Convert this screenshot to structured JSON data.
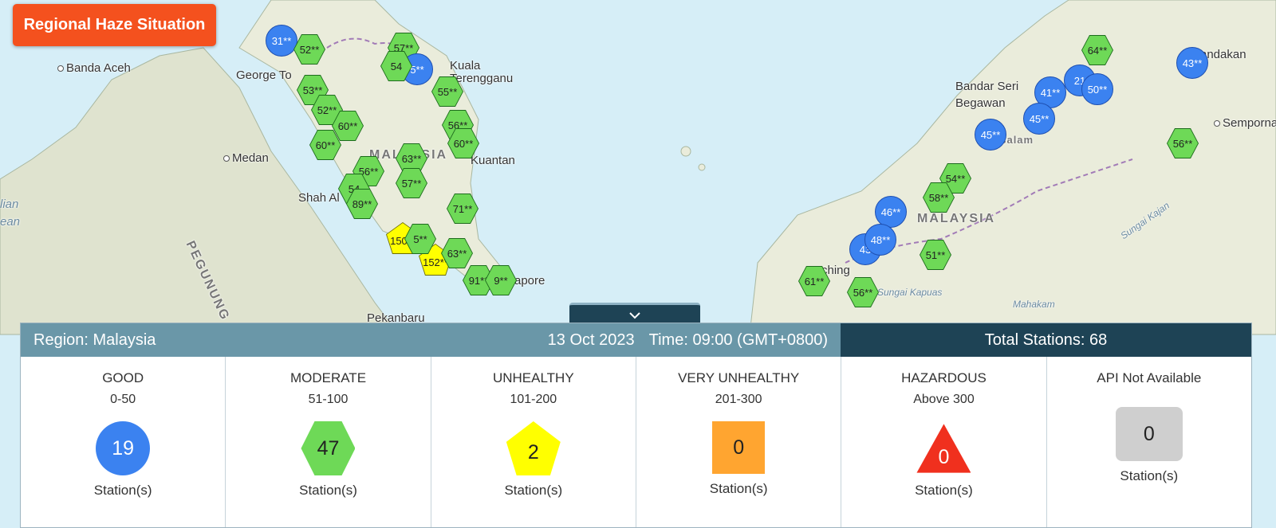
{
  "title_button": "Regional Haze Situation",
  "places": [
    "Banda Aceh",
    "George To",
    "Kuala Terengganu",
    "Medan",
    "Shah Al",
    "Kuantan",
    "Pekanbaru",
    "apore",
    "Bandar Seri Begawan",
    "andakan",
    "Semporna",
    "ching",
    "MALAYSIA",
    "MALAYSIA",
    "PEGUNUNG",
    "lian",
    "ean",
    "Sungai Kapuas",
    "Mahakam",
    "Sungai Kajan",
    "ssalam"
  ],
  "markers": [
    {
      "type": "circle",
      "label": "31**"
    },
    {
      "type": "hex",
      "label": "52**"
    },
    {
      "type": "hex",
      "label": "57**"
    },
    {
      "type": "circle",
      "label": "5**"
    },
    {
      "type": "hex",
      "label": "54"
    },
    {
      "type": "hex",
      "label": "53**"
    },
    {
      "type": "hex",
      "label": "55**"
    },
    {
      "type": "hex",
      "label": "52**"
    },
    {
      "type": "hex",
      "label": "60**"
    },
    {
      "type": "hex",
      "label": "56**"
    },
    {
      "type": "hex",
      "label": "60**"
    },
    {
      "type": "hex",
      "label": "60**"
    },
    {
      "type": "hex",
      "label": "63**"
    },
    {
      "type": "hex",
      "label": "56**"
    },
    {
      "type": "hex",
      "label": "57**"
    },
    {
      "type": "hex",
      "label": "54"
    },
    {
      "type": "hex",
      "label": "89**"
    },
    {
      "type": "hex",
      "label": "71**"
    },
    {
      "type": "pent",
      "label": "150**"
    },
    {
      "type": "pent",
      "label": "152**"
    },
    {
      "type": "hex",
      "label": "5**"
    },
    {
      "type": "hex",
      "label": "63**"
    },
    {
      "type": "hex",
      "label": "91**"
    },
    {
      "type": "hex",
      "label": "9**"
    },
    {
      "type": "hex",
      "label": "64**"
    },
    {
      "type": "circle",
      "label": "43**"
    },
    {
      "type": "circle",
      "label": "41**"
    },
    {
      "type": "circle",
      "label": "21"
    },
    {
      "type": "circle",
      "label": "50**"
    },
    {
      "type": "circle",
      "label": "45**"
    },
    {
      "type": "circle",
      "label": "45**"
    },
    {
      "type": "hex",
      "label": "56**"
    },
    {
      "type": "hex",
      "label": "54**"
    },
    {
      "type": "hex",
      "label": "58**"
    },
    {
      "type": "circle",
      "label": "46**"
    },
    {
      "type": "circle",
      "label": "43"
    },
    {
      "type": "circle",
      "label": "48**"
    },
    {
      "type": "hex",
      "label": "51**"
    },
    {
      "type": "hex",
      "label": "61**"
    },
    {
      "type": "hex",
      "label": "56**"
    }
  ],
  "panel": {
    "toggle_icon": "chevron-down-icon",
    "region": "Region: Malaysia",
    "date": "13 Oct 2023",
    "time": "Time: 09:00 (GMT+0800)",
    "total": "Total Stations: 68",
    "categories": [
      {
        "name": "GOOD",
        "range": "0-50",
        "count": "19",
        "unit": "Station(s)",
        "color": "#3b82f0"
      },
      {
        "name": "MODERATE",
        "range": "51-100",
        "count": "47",
        "unit": "Station(s)",
        "color": "#6ed957"
      },
      {
        "name": "UNHEALTHY",
        "range": "101-200",
        "count": "2",
        "unit": "Station(s)",
        "color": "#ffff00"
      },
      {
        "name": "VERY UNHEALTHY",
        "range": "201-300",
        "count": "0",
        "unit": "Station(s)",
        "color": "#ffa530"
      },
      {
        "name": "HAZARDOUS",
        "range": "Above 300",
        "count": "0",
        "unit": "Station(s)",
        "color": "#f0301e"
      },
      {
        "name": "API Not Available",
        "range": "",
        "count": "0",
        "unit": "Station(s)",
        "color": "#cfcfcf"
      }
    ]
  }
}
